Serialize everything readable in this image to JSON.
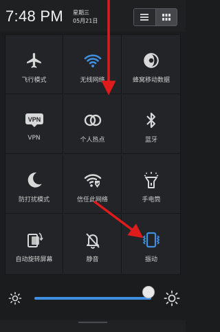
{
  "status_bar": {
    "time": "7:48 PM",
    "weekday": "星期三",
    "date": "05月21日"
  },
  "view_toggle": {
    "list_icon": "list-icon",
    "grid_icon": "grid-icon",
    "selected": "grid"
  },
  "tiles": [
    {
      "label": "飞行模式",
      "icon": "airplane-icon",
      "active": false
    },
    {
      "label": "无线网络",
      "icon": "wifi-icon",
      "active": true
    },
    {
      "label": "蜂窝移动数据",
      "icon": "cellular-data-icon",
      "active": false
    },
    {
      "label": "VPN",
      "icon": "vpn-icon",
      "active": false
    },
    {
      "label": "个人热点",
      "icon": "hotspot-icon",
      "active": false
    },
    {
      "label": "蓝牙",
      "icon": "bluetooth-icon",
      "active": false
    },
    {
      "label": "防打扰模式",
      "icon": "moon-icon",
      "active": false
    },
    {
      "label": "信任此网络",
      "icon": "trusted-wifi-icon",
      "active": false
    },
    {
      "label": "手电筒",
      "icon": "flashlight-icon",
      "active": false
    },
    {
      "label": "自动旋转屏幕",
      "icon": "rotate-screen-icon",
      "active": false
    },
    {
      "label": "静音",
      "icon": "mute-bell-icon",
      "active": false
    },
    {
      "label": "振动",
      "icon": "vibrate-icon",
      "active": true
    }
  ],
  "brightness": {
    "level_percent": 100,
    "low_icon": "brightness-low-icon",
    "high_icon": "brightness-high-icon"
  },
  "colors": {
    "accent": "#3f8fe0",
    "annotation_arrow": "#e01b1b"
  }
}
